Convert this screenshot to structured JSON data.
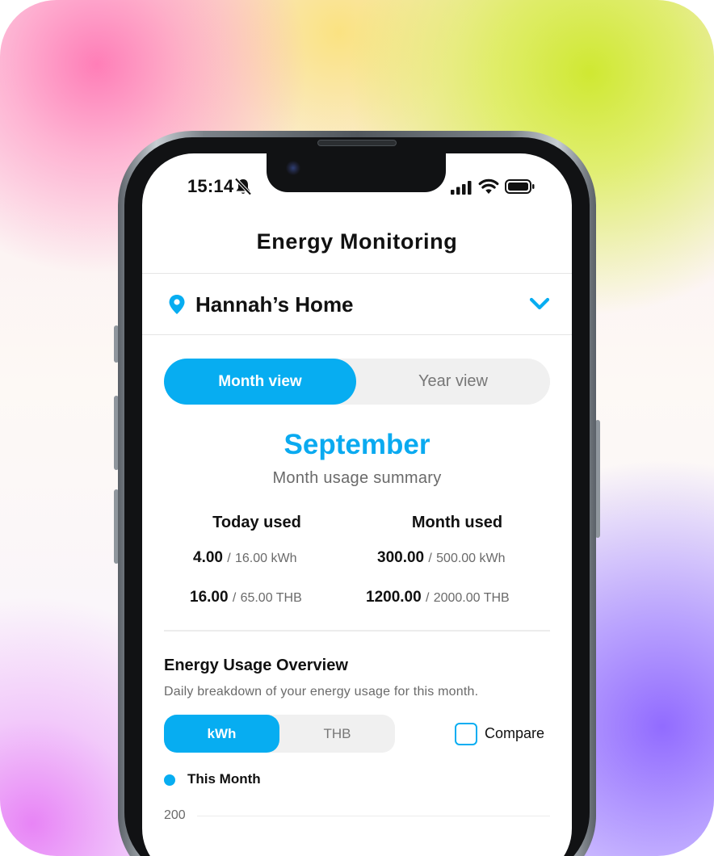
{
  "status_bar": {
    "time": "15:14",
    "icons": [
      "bell-slash-icon",
      "signal-icon",
      "wifi-icon",
      "battery-icon"
    ]
  },
  "header": {
    "title": "Energy Monitoring"
  },
  "location": {
    "name": "Hannah’s Home",
    "icon": "pin-icon",
    "dropdown_icon": "chevron-down-icon"
  },
  "view_toggle": {
    "active": "Month view",
    "inactive": "Year view"
  },
  "summary": {
    "month": "September",
    "subtitle": "Month usage summary",
    "today": {
      "label": "Today used",
      "kwh": "4.00",
      "kwh_limit": "16.00 kWh",
      "thb": "16.00",
      "thb_limit": "65.00 THB"
    },
    "month_used": {
      "label": "Month used",
      "kwh": "300.00",
      "kwh_limit": "500.00 kWh",
      "thb": "1200.00",
      "thb_limit": "2000.00 THB"
    },
    "separator": "/"
  },
  "overview": {
    "title": "Energy Usage Overview",
    "description": "Daily breakdown of your energy usage for this month.",
    "unit_active": "kWh",
    "unit_inactive": "THB",
    "compare_label": "Compare",
    "compare_checked": false,
    "legend_label": "This Month"
  },
  "chart_data": {
    "type": "bar",
    "series": [
      {
        "name": "This Month",
        "values": []
      }
    ],
    "y_ticks": [
      "200"
    ]
  },
  "colors": {
    "accent": "#07adf1",
    "text": "#111111",
    "muted": "#6a6a6a"
  }
}
